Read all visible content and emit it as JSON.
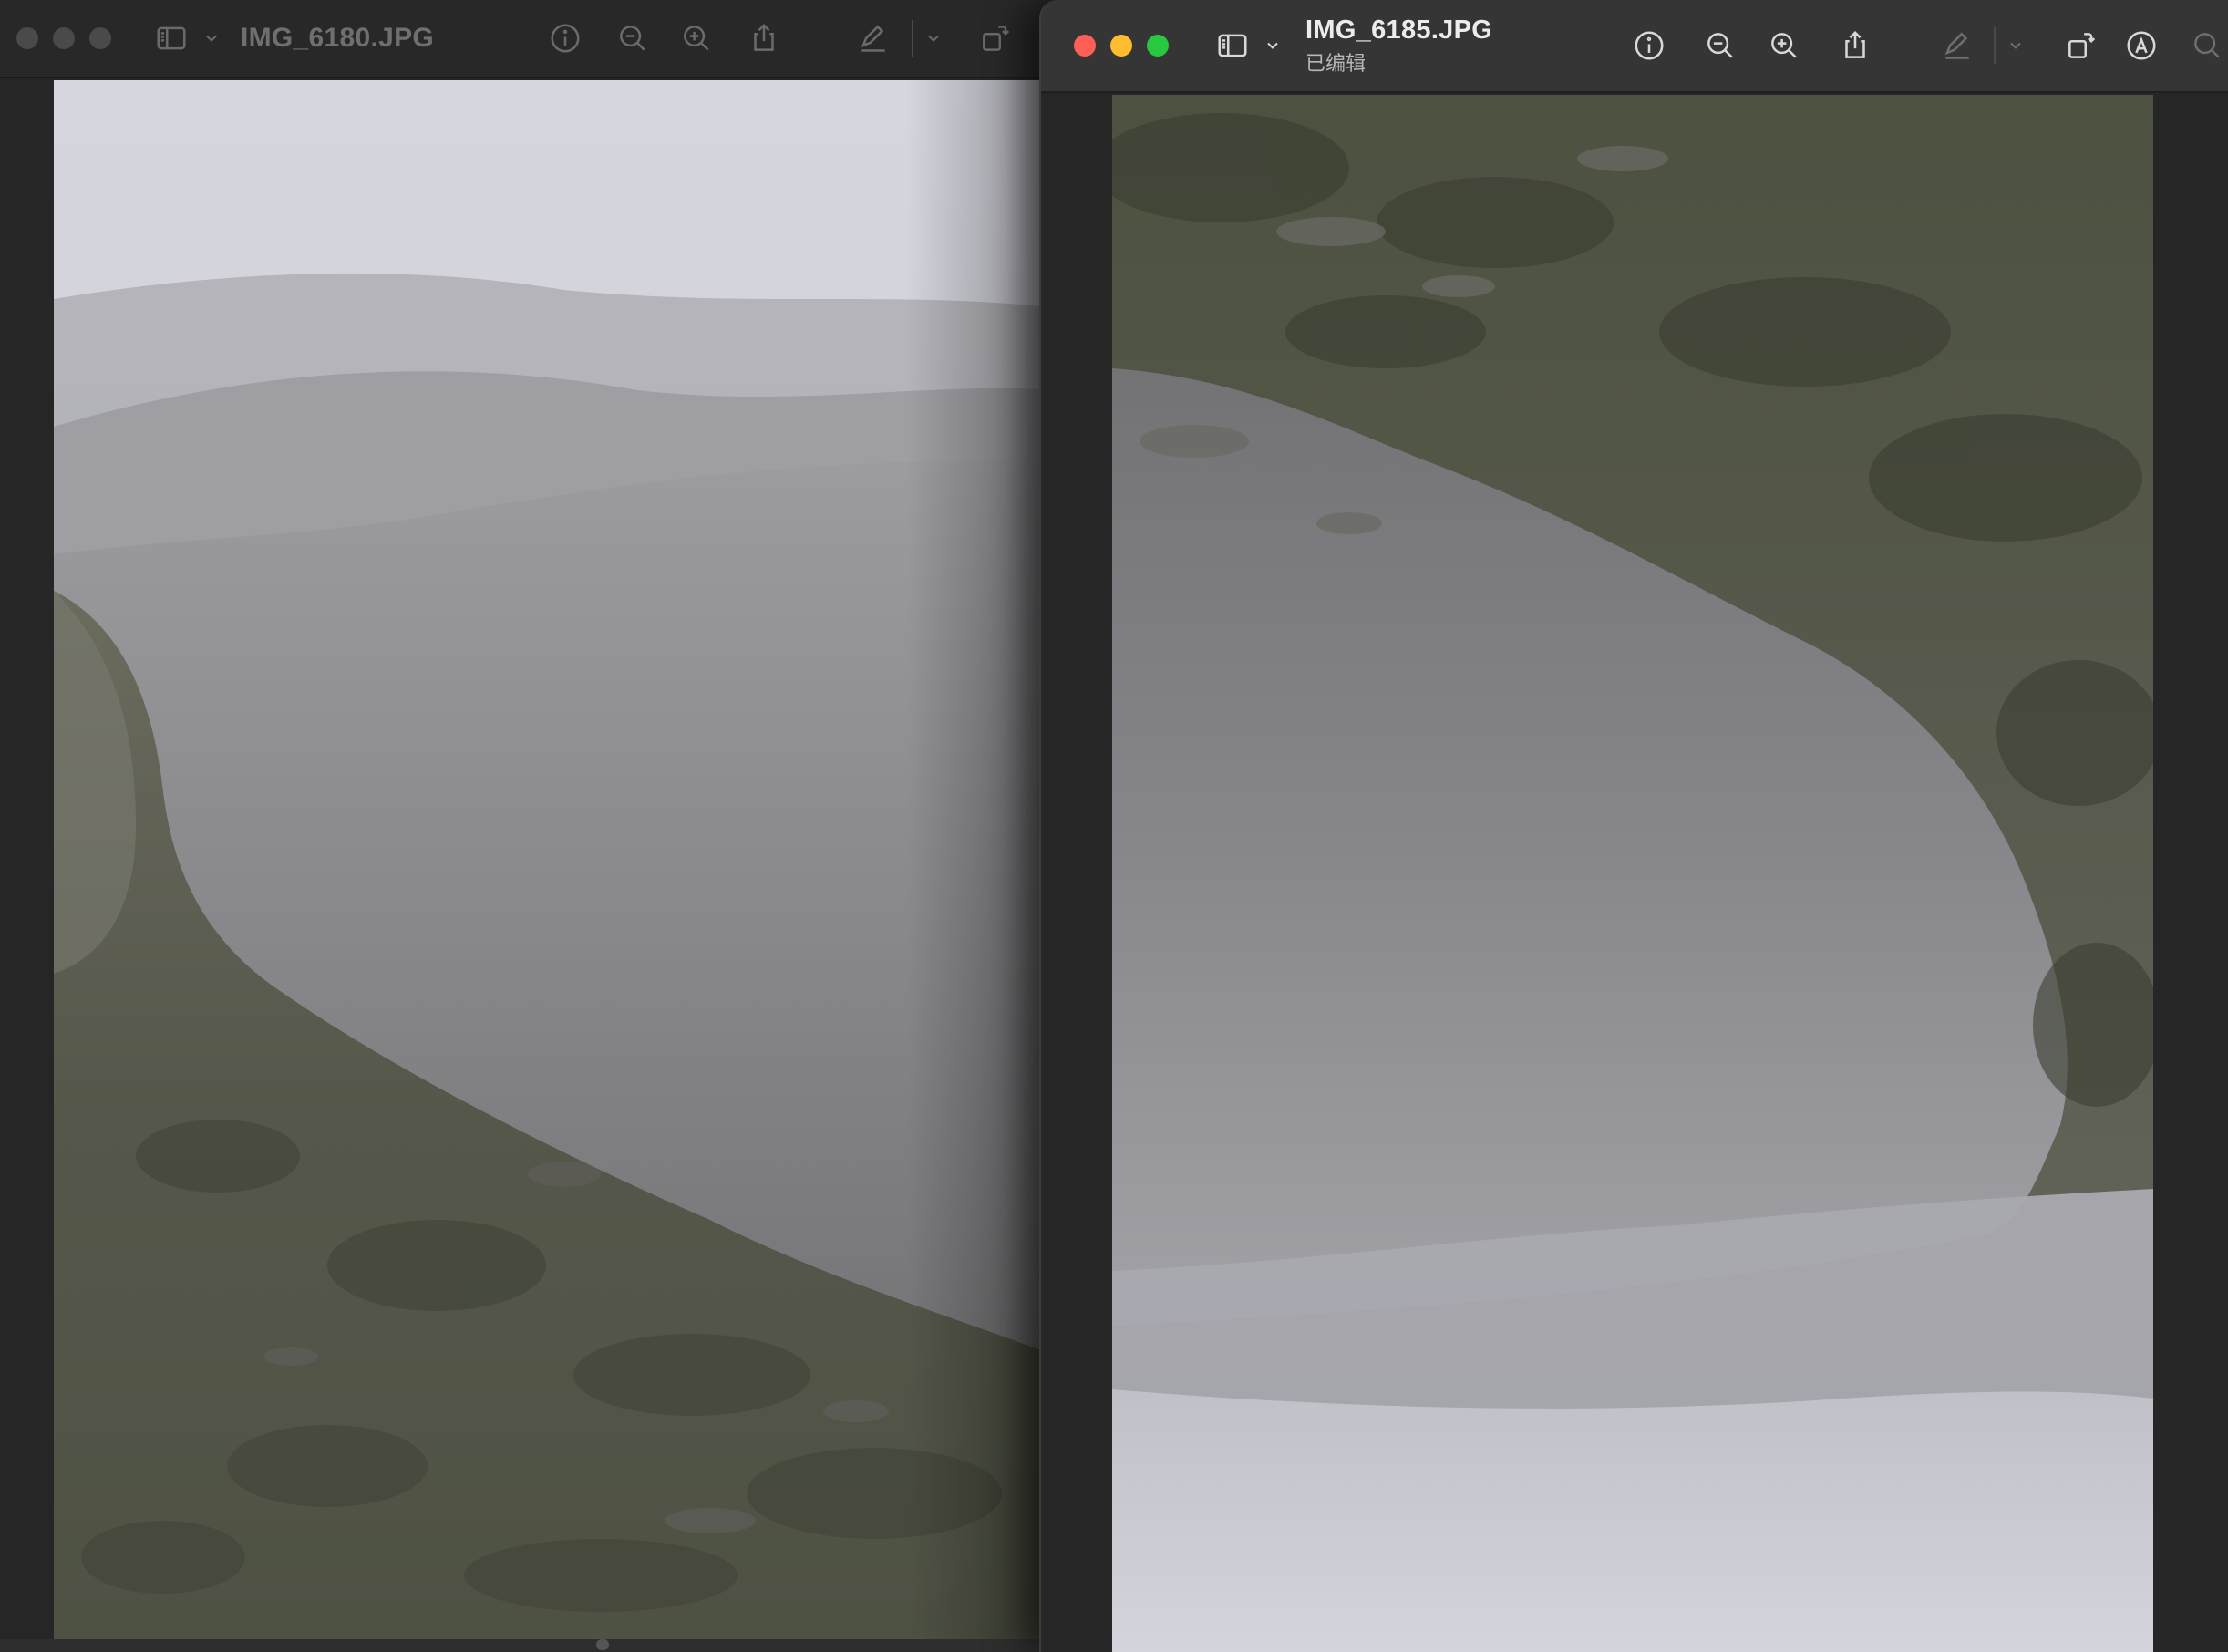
{
  "back_window": {
    "title": "IMG_6180.JPG",
    "icons": [
      "close-icon",
      "minimize-icon",
      "zoom-icon",
      "sidebar-icon",
      "chevron-down-icon",
      "info-icon",
      "zoom-out-icon",
      "zoom-in-icon",
      "share-icon",
      "markup-pen-icon",
      "chevron-down-icon",
      "rotate-icon"
    ]
  },
  "front_window": {
    "title": "IMG_6185.JPG",
    "subtitle": "已编辑",
    "icons": [
      "close-icon",
      "minimize-icon",
      "zoom-icon",
      "sidebar-icon",
      "chevron-down-icon",
      "info-icon",
      "zoom-out-icon",
      "zoom-in-icon",
      "share-icon",
      "markup-pen-icon",
      "chevron-down-icon",
      "rotate-icon",
      "markup-icon",
      "search-icon"
    ]
  },
  "colors": {
    "traffic_close": "#ff5f57",
    "traffic_minimize": "#febc2e",
    "traffic_zoom": "#28c840",
    "toolbar_active": "#353535",
    "toolbar_inactive": "#282828"
  }
}
